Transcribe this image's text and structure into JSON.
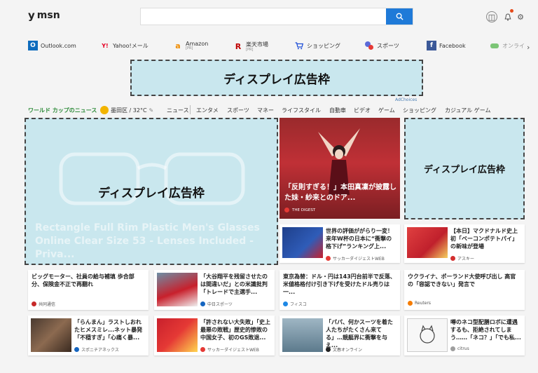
{
  "header": {
    "logo_mark": "y",
    "logo_text": "msn",
    "search_placeholder": "",
    "avatar_glyph": "◫",
    "bell_glyph": "🔔",
    "gear_glyph": "⚙",
    "search_glyph": "⌕"
  },
  "links": [
    {
      "label": "Outlook.com",
      "sub": "",
      "icon": "outlook-icon",
      "color": "#0f6cbd",
      "glyph": "O"
    },
    {
      "label": "Yahoo!メール",
      "sub": "",
      "icon": "yahoo-icon",
      "color": "#ffffff",
      "glyph": "Y!"
    },
    {
      "label": "Amazon",
      "sub": "[PR]",
      "icon": "amazon-icon",
      "color": "#ffffff",
      "glyph": "a"
    },
    {
      "label": "楽天市場",
      "sub": "[PR]",
      "icon": "rakuten-icon",
      "color": "#ffffff",
      "glyph": "R"
    },
    {
      "label": "ショッピング",
      "sub": "",
      "icon": "cart-icon",
      "color": "#ffffff",
      "glyph": "🛒"
    },
    {
      "label": "スポーツ",
      "sub": "",
      "icon": "sports-icon",
      "color": "#ffffff",
      "glyph": "⚽"
    },
    {
      "label": "Facebook",
      "sub": "",
      "icon": "facebook-icon",
      "color": "#3b5998",
      "glyph": "f"
    },
    {
      "label": "オンライ",
      "sub": "",
      "icon": "game-icon",
      "color": "#ffffff",
      "glyph": "🎮"
    }
  ],
  "ads": {
    "top_label": "ディスプレイ広告枠",
    "left_label": "ディスプレイ広告枠",
    "right_label": "ディスプレイ広告枠",
    "left_ghost": "Rectangle Full Rim Plastic Men's Glasses Online Clear Size 53 - Lenses Included - Priva...",
    "adchoices": "AdChoices"
  },
  "nav": {
    "title": "ワールド カップのニュース",
    "weather": "墨田区 / 32°C",
    "items": [
      "ニュース",
      "エンタメ",
      "スポーツ",
      "マネー",
      "ライフスタイル",
      "自動車",
      "ビデオ",
      "ゲーム",
      "ショッピング",
      "カジュアル ゲーム"
    ]
  },
  "hero": {
    "title": "「反則すぎる！」本田真凜が披露した妹・紗来とのドア...",
    "source": "THE DIGEST"
  },
  "cards": [
    {
      "title": "世界の評価ががらり一変！来年W杯の日本に“衝撃の格下げ”ランキング上...",
      "source": "サッカーダイジェストWEB"
    },
    {
      "title": "【本日】マクドナルド史上初「ベーコンポテトパイ」の新味が登場",
      "source": "アスキー"
    },
    {
      "title": "ビッグモーター、社員の給与補填 歩合部分、保険金不正で再翻れ",
      "source": "共同通信"
    },
    {
      "title": "「大谷翔平を残留させたのは間違いだ」との米識批判「トレードで主選手...",
      "source": "中日スポーツ"
    },
    {
      "title": "東京為替：ドル・円は143円台前半で反落、米値格格付け引き下げを受けたドル売りは一...",
      "source": "フィスコ"
    },
    {
      "title": "ウクライナ、ポーランド大使呼び出し 高官の「容認できない」発言で",
      "source": "Reuters"
    },
    {
      "title": "「らんまん」ラストしおれたヒメスミレ...ネット暴発「不穏すぎ」「心痛く暴...",
      "source": "スポニチアネックス"
    },
    {
      "title": "「許されない大失敗」「史上最悪の敗戦」歴史的惨敗の中国女子、初のGS敗退...",
      "source": "サッカーダイジェストWEB"
    },
    {
      "title": "「パパ、何かスーツを着た人たちがたくさん来てる」…競艇界に衝撃を与え...",
      "source": "文春オンライン"
    },
    {
      "title": "噂のネコ型配膳ロボに遭遇するも、拒絶されてしまう……「ネコ？」「でも私...",
      "source": "citrus"
    }
  ]
}
